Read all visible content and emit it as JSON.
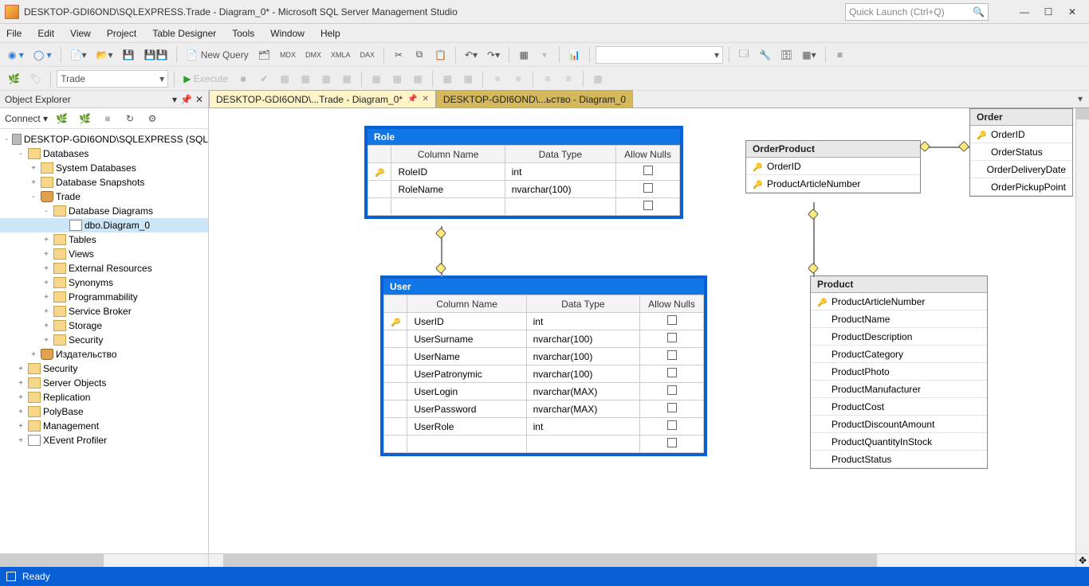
{
  "title": "DESKTOP-GDI6OND\\SQLEXPRESS.Trade - Diagram_0* - Microsoft SQL Server Management Studio",
  "quickLaunch": {
    "placeholder": "Quick Launch (Ctrl+Q)"
  },
  "menu": [
    "File",
    "Edit",
    "View",
    "Project",
    "Table Designer",
    "Tools",
    "Window",
    "Help"
  ],
  "toolbar1": {
    "newQuery": "New Query"
  },
  "toolbar2": {
    "dbCombo": "Trade",
    "execute": "Execute"
  },
  "objectExplorer": {
    "title": "Object Explorer",
    "connect": "Connect",
    "nodes": [
      {
        "ind": 4,
        "exp": "-",
        "ico": "server",
        "label": "DESKTOP-GDI6OND\\SQLEXPRESS (SQL"
      },
      {
        "ind": 20,
        "exp": "-",
        "ico": "folder",
        "label": "Databases"
      },
      {
        "ind": 36,
        "exp": "+",
        "ico": "folder",
        "label": "System Databases"
      },
      {
        "ind": 36,
        "exp": "+",
        "ico": "folder",
        "label": "Database Snapshots"
      },
      {
        "ind": 36,
        "exp": "-",
        "ico": "db",
        "label": "Trade"
      },
      {
        "ind": 52,
        "exp": "-",
        "ico": "folder",
        "label": "Database Diagrams"
      },
      {
        "ind": 72,
        "exp": "",
        "ico": "diagram",
        "label": "dbo.Diagram_0",
        "sel": true
      },
      {
        "ind": 52,
        "exp": "+",
        "ico": "folder",
        "label": "Tables"
      },
      {
        "ind": 52,
        "exp": "+",
        "ico": "folder",
        "label": "Views"
      },
      {
        "ind": 52,
        "exp": "+",
        "ico": "folder",
        "label": "External Resources"
      },
      {
        "ind": 52,
        "exp": "+",
        "ico": "folder",
        "label": "Synonyms"
      },
      {
        "ind": 52,
        "exp": "+",
        "ico": "folder",
        "label": "Programmability"
      },
      {
        "ind": 52,
        "exp": "+",
        "ico": "folder",
        "label": "Service Broker"
      },
      {
        "ind": 52,
        "exp": "+",
        "ico": "folder",
        "label": "Storage"
      },
      {
        "ind": 52,
        "exp": "+",
        "ico": "folder",
        "label": "Security"
      },
      {
        "ind": 36,
        "exp": "+",
        "ico": "db",
        "label": "Издательство"
      },
      {
        "ind": 20,
        "exp": "+",
        "ico": "folder",
        "label": "Security"
      },
      {
        "ind": 20,
        "exp": "+",
        "ico": "folder",
        "label": "Server Objects"
      },
      {
        "ind": 20,
        "exp": "+",
        "ico": "folder",
        "label": "Replication"
      },
      {
        "ind": 20,
        "exp": "+",
        "ico": "folder",
        "label": "PolyBase"
      },
      {
        "ind": 20,
        "exp": "+",
        "ico": "folder",
        "label": "Management"
      },
      {
        "ind": 20,
        "exp": "+",
        "ico": "diagram",
        "label": "XEvent Profiler"
      }
    ]
  },
  "tabs": [
    {
      "label": "DESKTOP-GDI6OND\\...Trade - Diagram_0*",
      "active": true
    },
    {
      "label": "DESKTOP-GDI6OND\\...ьство - Diagram_0",
      "active": false
    }
  ],
  "diagram": {
    "role": {
      "title": "Role",
      "headers": [
        "Column Name",
        "Data Type",
        "Allow Nulls"
      ],
      "rows": [
        {
          "key": true,
          "name": "RoleID",
          "type": "int",
          "nulls": false
        },
        {
          "key": false,
          "name": "RoleName",
          "type": "nvarchar(100)",
          "nulls": false
        },
        {
          "key": false,
          "name": "",
          "type": "",
          "nulls": false
        }
      ]
    },
    "user": {
      "title": "User",
      "headers": [
        "Column Name",
        "Data Type",
        "Allow Nulls"
      ],
      "rows": [
        {
          "key": true,
          "name": "UserID",
          "type": "int",
          "nulls": false
        },
        {
          "key": false,
          "name": "UserSurname",
          "type": "nvarchar(100)",
          "nulls": false
        },
        {
          "key": false,
          "name": "UserName",
          "type": "nvarchar(100)",
          "nulls": false
        },
        {
          "key": false,
          "name": "UserPatronymic",
          "type": "nvarchar(100)",
          "nulls": false
        },
        {
          "key": false,
          "name": "UserLogin",
          "type": "nvarchar(MAX)",
          "nulls": false
        },
        {
          "key": false,
          "name": "UserPassword",
          "type": "nvarchar(MAX)",
          "nulls": false
        },
        {
          "key": false,
          "name": "UserRole",
          "type": "int",
          "nulls": false
        },
        {
          "key": false,
          "name": "",
          "type": "",
          "nulls": false
        }
      ]
    },
    "orderProduct": {
      "title": "OrderProduct",
      "cols": [
        {
          "key": true,
          "name": "OrderID"
        },
        {
          "key": true,
          "name": "ProductArticleNumber"
        }
      ]
    },
    "order": {
      "title": "Order",
      "cols": [
        {
          "key": true,
          "name": "OrderID"
        },
        {
          "key": false,
          "name": "OrderStatus"
        },
        {
          "key": false,
          "name": "OrderDeliveryDate"
        },
        {
          "key": false,
          "name": "OrderPickupPoint"
        }
      ]
    },
    "product": {
      "title": "Product",
      "cols": [
        {
          "key": true,
          "name": "ProductArticleNumber"
        },
        {
          "key": false,
          "name": "ProductName"
        },
        {
          "key": false,
          "name": "ProductDescription"
        },
        {
          "key": false,
          "name": "ProductCategory"
        },
        {
          "key": false,
          "name": "ProductPhoto"
        },
        {
          "key": false,
          "name": "ProductManufacturer"
        },
        {
          "key": false,
          "name": "ProductCost"
        },
        {
          "key": false,
          "name": "ProductDiscountAmount"
        },
        {
          "key": false,
          "name": "ProductQuantityInStock"
        },
        {
          "key": false,
          "name": "ProductStatus"
        }
      ]
    }
  },
  "status": "Ready"
}
